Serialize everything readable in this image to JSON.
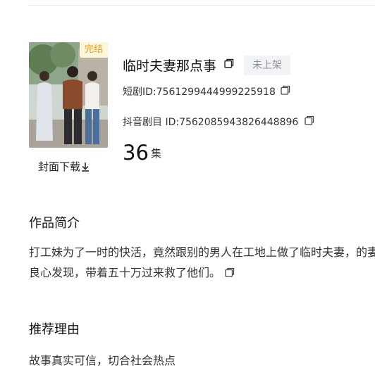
{
  "cover": {
    "badge": "完结",
    "download_label": "封面下载"
  },
  "drama": {
    "title": "临时夫妻那点事",
    "status": "未上架",
    "short_id_label": "短剧ID:7561299444999225918",
    "douyin_id_label": "抖音剧目 ID:7562085943826448896",
    "episodes": "36",
    "episodes_unit": "集"
  },
  "intro": {
    "heading": "作品简介",
    "text": "打工妹为了一时的快活，竟然跟别的男人在工地上做了临时夫妻，的妻子良心发现，带着五十万过来救了他们。"
  },
  "reason": {
    "heading": "推荐理由",
    "text": "故事真实可信，切合社会热点"
  },
  "colors": {
    "badge_text": "#e5a117",
    "badge_bg": "#fff6dc",
    "status_bg": "#f2f3f5",
    "status_text": "#8a8f99"
  },
  "icons": [
    "copy-icon",
    "download-icon"
  ]
}
